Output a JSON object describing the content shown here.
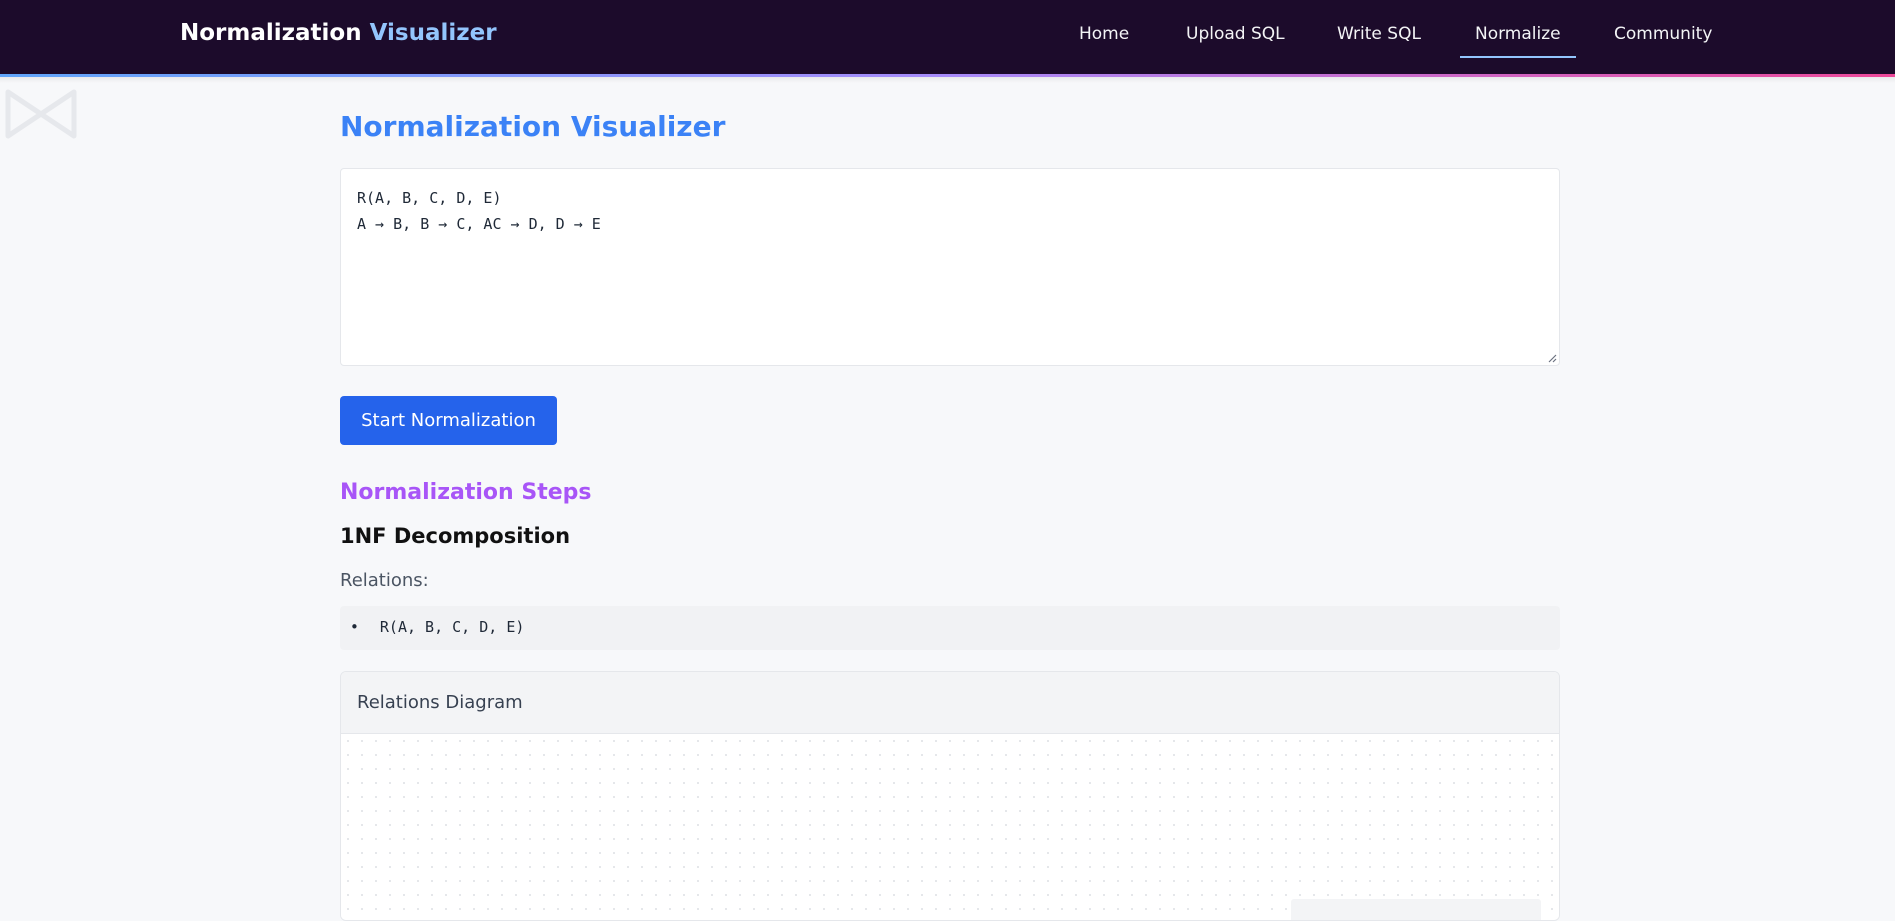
{
  "navbar": {
    "brand_main": "Normalization",
    "brand_accent": "Visualizer",
    "links": [
      {
        "label": "Home",
        "active": false
      },
      {
        "label": "Upload SQL",
        "active": false
      },
      {
        "label": "Write SQL",
        "active": false
      },
      {
        "label": "Normalize",
        "active": true
      },
      {
        "label": "Community",
        "active": false
      }
    ],
    "colors": {
      "background": "#1c0b2b",
      "accent": "#93c5fd"
    }
  },
  "background_icon": "bowtie-logo-icon",
  "main": {
    "title": "Normalization Visualizer",
    "schema_input": "R(A, B, C, D, E)\nA → B, B → C, AC → D, D → E",
    "start_button_label": "Start Normalization",
    "steps_title": "Normalization Steps",
    "step": {
      "heading": "1NF Decomposition",
      "relations_label": "Relations:",
      "relations": [
        "R(A, B, C, D, E)"
      ]
    },
    "diagram": {
      "title": "Relations Diagram"
    }
  },
  "colors": {
    "title": "#3b82f6",
    "steps_title": "#a855f7",
    "button": "#2563eb"
  }
}
